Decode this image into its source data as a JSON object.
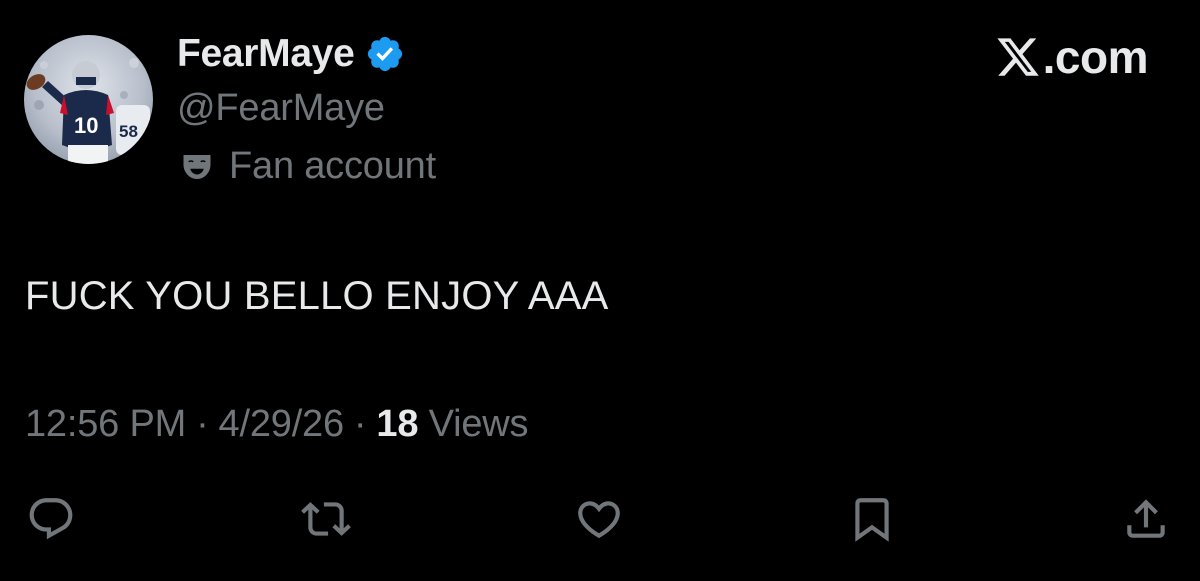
{
  "author": {
    "display_name": "FearMaye",
    "handle": "@FearMaye",
    "label": "Fan account",
    "label_icon": "theater-masks-icon",
    "verified": true,
    "verified_color": "#1d9bf0",
    "avatar_jersey_number": "10"
  },
  "brand": {
    "text": ".com",
    "icon": "x-logo-icon"
  },
  "tweet": {
    "text": "FUCK YOU BELLO ENJOY AAA"
  },
  "meta": {
    "time": "12:56 PM",
    "separator": "·",
    "date": "4/29/26",
    "views_count": "18",
    "views_label": "Views"
  },
  "actions": [
    {
      "name": "reply",
      "icon": "reply-icon"
    },
    {
      "name": "retweet",
      "icon": "retweet-icon"
    },
    {
      "name": "like",
      "icon": "heart-icon"
    },
    {
      "name": "bookmark",
      "icon": "bookmark-icon"
    },
    {
      "name": "share",
      "icon": "share-icon"
    }
  ],
  "colors": {
    "background": "#000000",
    "primary_text": "#e7e9ea",
    "secondary_text": "#71767b",
    "icon": "#71767b"
  }
}
